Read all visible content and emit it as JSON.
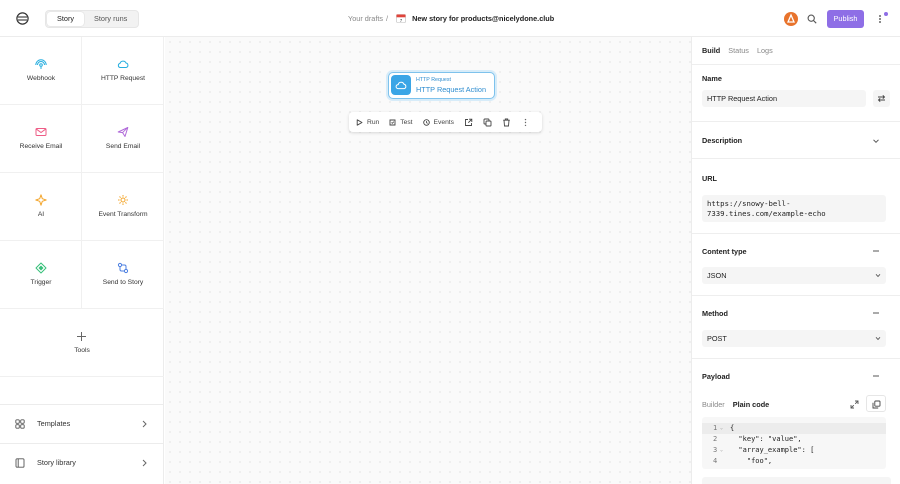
{
  "header": {
    "tabs": [
      {
        "label": "Story",
        "active": true
      },
      {
        "label": "Story runs",
        "active": false
      }
    ],
    "breadcrumb": {
      "drafts": "Your drafts",
      "separator": "/",
      "story_name": "New story for products@nicelydone.club"
    },
    "publish_label": "Publish",
    "brand_color": "#8e6ee6"
  },
  "sidebar": {
    "actions": [
      {
        "label": "Webhook",
        "icon": "webhook-icon",
        "color": "#27aedf"
      },
      {
        "label": "HTTP Request",
        "icon": "cloud-icon",
        "color": "#27aedf"
      },
      {
        "label": "Receive Email",
        "icon": "envelope-icon",
        "color": "#ee5c86"
      },
      {
        "label": "Send Email",
        "icon": "send-icon",
        "color": "#b06ad9"
      },
      {
        "label": "AI",
        "icon": "sparkle-icon",
        "color": "#f3a52b"
      },
      {
        "label": "Event Transform",
        "icon": "transform-icon",
        "color": "#f3a52b"
      },
      {
        "label": "Trigger",
        "icon": "trigger-icon",
        "color": "#37c07a"
      },
      {
        "label": "Send to Story",
        "icon": "send-to-story-icon",
        "color": "#4c7fe0"
      }
    ],
    "tools_label": "Tools",
    "links": [
      {
        "label": "Templates",
        "icon": "templates-icon"
      },
      {
        "label": "Story library",
        "icon": "library-icon"
      }
    ]
  },
  "canvas": {
    "node": {
      "type": "HTTP Request",
      "name": "HTTP Request Action"
    },
    "toolbar": {
      "run": "Run",
      "test": "Test",
      "events": "Events"
    }
  },
  "panel": {
    "tabs": [
      {
        "label": "Build",
        "active": true
      },
      {
        "label": "Status",
        "active": false
      },
      {
        "label": "Logs",
        "active": false
      }
    ],
    "name_label": "Name",
    "name_value": "HTTP Request Action",
    "description_label": "Description",
    "url_label": "URL",
    "url_value": "https://snowy-bell-\n7339.tines.com/example-echo",
    "content_type_label": "Content type",
    "content_type_value": "JSON",
    "method_label": "Method",
    "method_value": "POST",
    "payload_label": "Payload",
    "payload_tabs": [
      {
        "label": "Builder",
        "active": false
      },
      {
        "label": "Plain code",
        "active": true
      }
    ],
    "code_lines": [
      {
        "num": "1",
        "fold": true,
        "text": "{"
      },
      {
        "num": "2",
        "fold": false,
        "text": "  \"key\": \"value\","
      },
      {
        "num": "3",
        "fold": true,
        "text": "  \"array_example\": ["
      },
      {
        "num": "4",
        "fold": false,
        "text": "    \"foo\","
      }
    ]
  }
}
